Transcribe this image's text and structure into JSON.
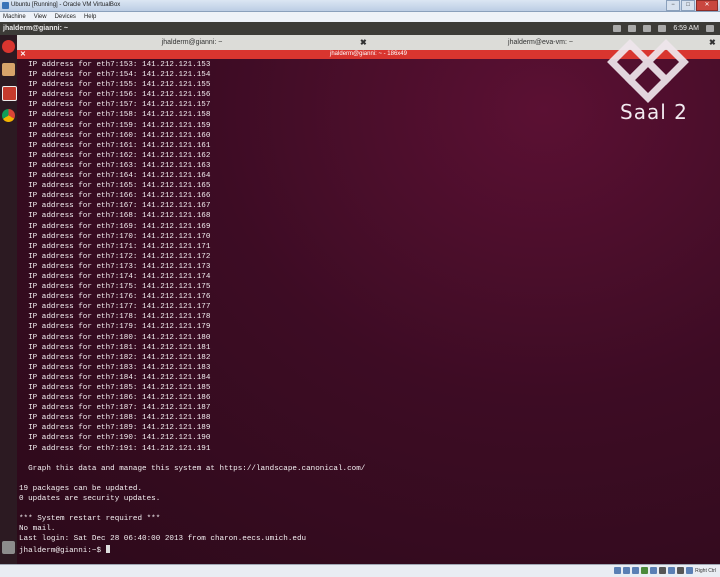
{
  "vbox": {
    "title": "Ubuntu [Running] - Oracle VM VirtualBox",
    "menu": [
      "Machine",
      "View",
      "Devices",
      "Help"
    ],
    "win_buttons": [
      "−",
      "□",
      "✕"
    ],
    "host_key": "Right Ctrl"
  },
  "panel": {
    "title": "jhalderm@gianni: ~",
    "clock": "6:59 AM"
  },
  "tabs": [
    {
      "label": "jhalderm@gianni: ~"
    },
    {
      "label": "jhalderm@eva-vm: ~"
    }
  ],
  "terminal": {
    "title": "jhalderm@gianni: ~ - 186x49",
    "lines": [
      "  IP address for eth7:153: 141.212.121.153",
      "  IP address for eth7:154: 141.212.121.154",
      "  IP address for eth7:155: 141.212.121.155",
      "  IP address for eth7:156: 141.212.121.156",
      "  IP address for eth7:157: 141.212.121.157",
      "  IP address for eth7:158: 141.212.121.158",
      "  IP address for eth7:159: 141.212.121.159",
      "  IP address for eth7:160: 141.212.121.160",
      "  IP address for eth7:161: 141.212.121.161",
      "  IP address for eth7:162: 141.212.121.162",
      "  IP address for eth7:163: 141.212.121.163",
      "  IP address for eth7:164: 141.212.121.164",
      "  IP address for eth7:165: 141.212.121.165",
      "  IP address for eth7:166: 141.212.121.166",
      "  IP address for eth7:167: 141.212.121.167",
      "  IP address for eth7:168: 141.212.121.168",
      "  IP address for eth7:169: 141.212.121.169",
      "  IP address for eth7:170: 141.212.121.170",
      "  IP address for eth7:171: 141.212.121.171",
      "  IP address for eth7:172: 141.212.121.172",
      "  IP address for eth7:173: 141.212.121.173",
      "  IP address for eth7:174: 141.212.121.174",
      "  IP address for eth7:175: 141.212.121.175",
      "  IP address for eth7:176: 141.212.121.176",
      "  IP address for eth7:177: 141.212.121.177",
      "  IP address for eth7:178: 141.212.121.178",
      "  IP address for eth7:179: 141.212.121.179",
      "  IP address for eth7:180: 141.212.121.180",
      "  IP address for eth7:181: 141.212.121.181",
      "  IP address for eth7:182: 141.212.121.182",
      "  IP address for eth7:183: 141.212.121.183",
      "  IP address for eth7:184: 141.212.121.184",
      "  IP address for eth7:185: 141.212.121.185",
      "  IP address for eth7:186: 141.212.121.186",
      "  IP address for eth7:187: 141.212.121.187",
      "  IP address for eth7:188: 141.212.121.188",
      "  IP address for eth7:189: 141.212.121.189",
      "  IP address for eth7:190: 141.212.121.190",
      "  IP address for eth7:191: 141.212.121.191",
      "",
      "  Graph this data and manage this system at https://landscape.canonical.com/",
      "",
      "19 packages can be updated.",
      "0 updates are security updates.",
      "",
      "*** System restart required ***",
      "No mail.",
      "Last login: Sat Dec 28 06:40:00 2013 from charon.eecs.umich.edu"
    ],
    "prompt": "jhalderm@gianni:~$ "
  },
  "overlay": {
    "label": "Saal 2"
  },
  "colors": {
    "terminal_bg": "#3d0c24",
    "title_bar": "#d9352f",
    "panel": "#3c3b37"
  }
}
